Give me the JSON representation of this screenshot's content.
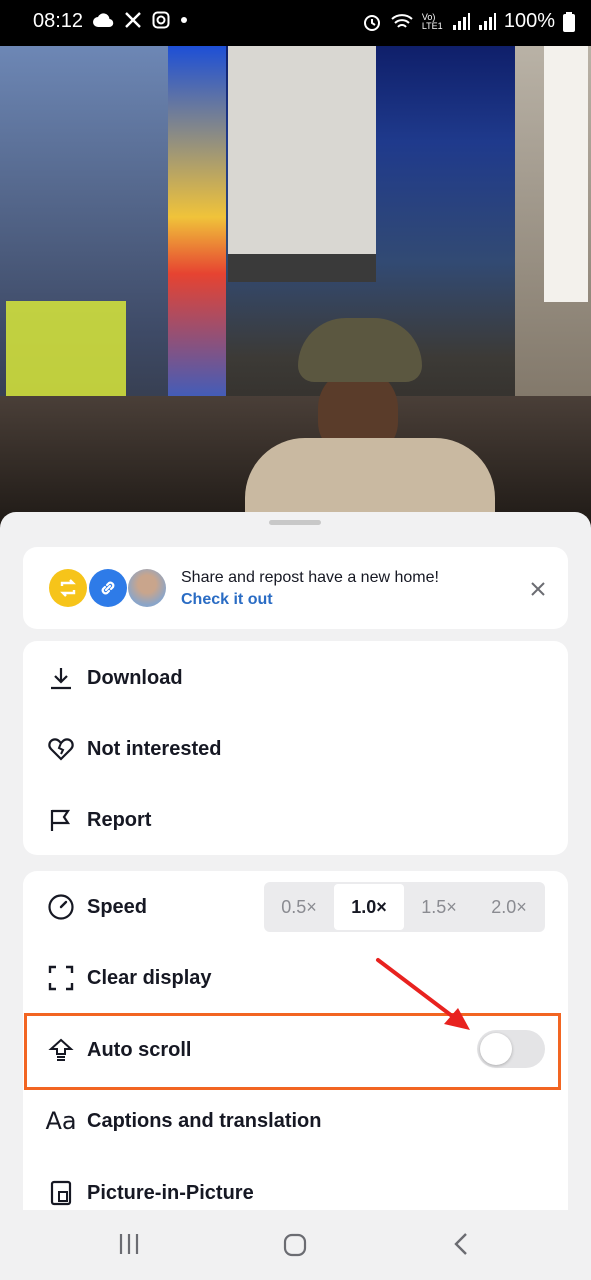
{
  "status_bar": {
    "time": "08:12",
    "battery": "100%",
    "network": "Vo) LTE1"
  },
  "banner": {
    "title": "Share and repost have a new home!",
    "link": "Check it out",
    "colors": {
      "repost": "#f6c41a",
      "link": "#2e7be8",
      "link_text": "#2a6cc4"
    }
  },
  "actions": [
    {
      "label": "Download",
      "icon": "download-icon"
    },
    {
      "label": "Not interested",
      "icon": "broken-heart-icon"
    },
    {
      "label": "Report",
      "icon": "flag-icon"
    }
  ],
  "settings": {
    "speed": {
      "label": "Speed",
      "icon": "speedometer-icon",
      "options": [
        "0.5×",
        "1.0×",
        "1.5×",
        "2.0×"
      ],
      "selected": "1.0×"
    },
    "clear_display": {
      "label": "Clear display",
      "icon": "corners-icon"
    },
    "auto_scroll": {
      "label": "Auto scroll",
      "icon": "auto-scroll-icon",
      "enabled": false
    },
    "captions": {
      "label": "Captions and translation",
      "icon": "aa-icon"
    },
    "pip": {
      "label": "Picture-in-Picture",
      "icon": "pip-icon"
    }
  },
  "annotation": {
    "color": "#f26522",
    "arrow_color": "#e8221f"
  }
}
